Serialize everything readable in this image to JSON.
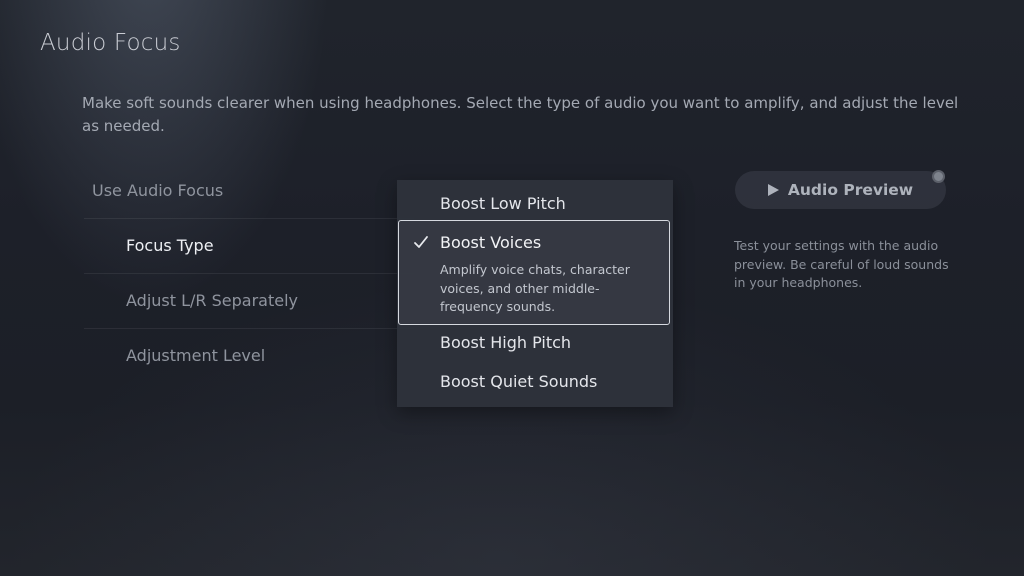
{
  "page": {
    "title": "Audio Focus",
    "description": "Make soft sounds clearer when using headphones. Select the type of audio you want to amplify, and adjust the level as needed."
  },
  "settings": {
    "items": [
      {
        "label": "Use Audio Focus"
      },
      {
        "label": "Focus Type"
      },
      {
        "label": "Adjust L/R Separately"
      },
      {
        "label": "Adjustment Level"
      }
    ]
  },
  "focus_type_menu": {
    "options": [
      {
        "label": "Boost Low Pitch"
      },
      {
        "label": "Boost Voices",
        "selected": true,
        "description": "Amplify voice chats, character voices, and other middle-frequency sounds."
      },
      {
        "label": "Boost High Pitch"
      },
      {
        "label": "Boost Quiet Sounds"
      }
    ],
    "check_icon": "check-icon"
  },
  "audio_preview": {
    "button_label": "Audio Preview",
    "play_icon": "play-icon",
    "options_icon": "options-button-icon",
    "note": "Test your settings with the audio preview. Be careful of loud sounds in your headphones."
  },
  "colors": {
    "background": "#1e2129",
    "menu_background": "#2e323b",
    "selection_border": "#d6d9df"
  }
}
